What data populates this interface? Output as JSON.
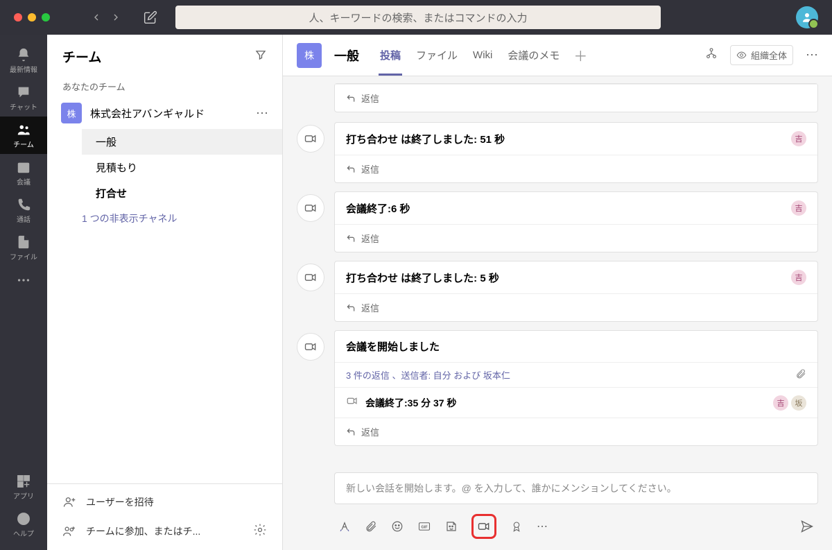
{
  "search": {
    "placeholder": "人、キーワードの検索、またはコマンドの入力"
  },
  "rail": {
    "activity": "最新情報",
    "chat": "チャット",
    "teams": "チーム",
    "meetings": "会議",
    "calls": "通話",
    "files": "ファイル",
    "apps": "アプリ",
    "help": "ヘルプ"
  },
  "teamsPanel": {
    "title": "チーム",
    "yourTeams": "あなたのチーム",
    "team": {
      "avatar": "株",
      "name": "株式会社アバンギャルド"
    },
    "channels": [
      "一般",
      "見積もり",
      "打合せ"
    ],
    "hiddenChannels": "1 つの非表示チャネル",
    "invite": "ユーザーを招待",
    "joinCreate": "チームに参加、またはチ..."
  },
  "header": {
    "avatar": "株",
    "channelName": "一般",
    "tabs": [
      "投稿",
      "ファイル",
      "Wiki",
      "会議のメモ"
    ],
    "orgBadge": "組織全体"
  },
  "messages": {
    "reply": "返信",
    "m0": {
      "title": ""
    },
    "m1": {
      "title": "打ち合わせ は終了しました: 51 秒",
      "badge": "吉"
    },
    "m2": {
      "title": "会議終了:6 秒",
      "badge": "吉"
    },
    "m3": {
      "title": "打ち合わせ は終了しました: 5 秒",
      "badge": "吉"
    },
    "m4": {
      "title": "会議を開始しました",
      "replyInfo": "3 件の返信 、送信者: 自分 および 坂本仁",
      "subText": "会議終了:35 分 37 秒",
      "badges": [
        "吉",
        "坂"
      ]
    }
  },
  "compose": {
    "placeholder": "新しい会話を開始します。@ を入力して、誰かにメンションしてください。"
  }
}
